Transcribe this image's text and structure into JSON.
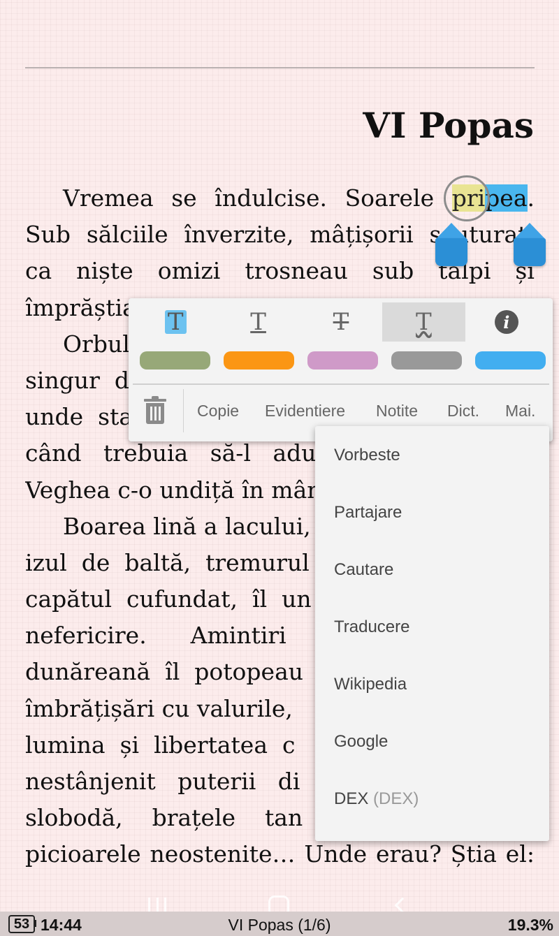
{
  "chapter": {
    "title": "VI Popas"
  },
  "text_lines": [
    {
      "words": [
        "Vremea",
        "se",
        "îndulcise.",
        "Soarele"
      ],
      "sel_a": "pri",
      "sel_b": "pea",
      "trail": "."
    },
    {
      "words": [
        "Sub",
        "sălciile",
        "înverzite,",
        "mâțișorii",
        "scuturați"
      ]
    },
    {
      "words": [
        "ca",
        "niște",
        "omizi",
        "trosneau",
        "sub",
        "tălpi",
        "și"
      ]
    },
    {
      "words": [
        "împrăștia"
      ]
    },
    {
      "words": [
        "Orbul"
      ]
    },
    {
      "words": [
        "singur",
        "d"
      ]
    },
    {
      "words": [
        "unde",
        "sta"
      ]
    },
    {
      "words": [
        "când",
        "trebuia",
        "să-l",
        "aduc"
      ]
    },
    {
      "words": [
        "Veghea c-o undiță în mân"
      ]
    },
    {
      "words": [
        "Boarea lină a lacului,"
      ]
    },
    {
      "words": [
        "izul",
        "de",
        "baltă,",
        "tremurul"
      ]
    },
    {
      "words": [
        "capătul",
        "cufundat,",
        "îl",
        "un"
      ]
    },
    {
      "words": [
        "nefericire.",
        "Amintiri",
        ""
      ]
    },
    {
      "words": [
        "dunăreană",
        "îl",
        "potopeau"
      ]
    },
    {
      "words": [
        "îmbrățișări cu valurile,"
      ]
    },
    {
      "words": [
        "lumina",
        "și",
        "libertatea",
        "c"
      ]
    },
    {
      "words": [
        "nestânjenit",
        "puterii",
        "di"
      ]
    },
    {
      "words": [
        "slobodă,",
        "brațele",
        "tan"
      ]
    },
    {
      "words": [
        "picioarele",
        "neostenite…",
        "Unde",
        "erau?",
        "Știa",
        "el:"
      ]
    }
  ],
  "toolbar": {
    "styles": [
      {
        "name": "highlight-style",
        "glyph": "T"
      },
      {
        "name": "underline-style",
        "glyph": "T"
      },
      {
        "name": "strikethrough-style",
        "glyph": "T"
      },
      {
        "name": "squiggly-style",
        "glyph": "T"
      },
      {
        "name": "info",
        "glyph": "i"
      }
    ],
    "colors": [
      "#97a878",
      "#fb9614",
      "#cf9ac8",
      "#999999",
      "#42aef0"
    ],
    "actions": {
      "copy": "Copie",
      "highlight": "Evidentiere",
      "notes": "Notite",
      "dict": "Dict.",
      "more": "Mai."
    }
  },
  "menu": {
    "items": [
      "Vorbeste",
      "Partajare",
      "Cautare",
      "Traducere",
      "Wikipedia",
      "Google"
    ],
    "dex": {
      "label": "DEX",
      "suffix": "(DEX)"
    }
  },
  "status": {
    "battery": "53",
    "time": "14:44",
    "title": "VI Popas (1/6)",
    "progress": "19.3%"
  }
}
